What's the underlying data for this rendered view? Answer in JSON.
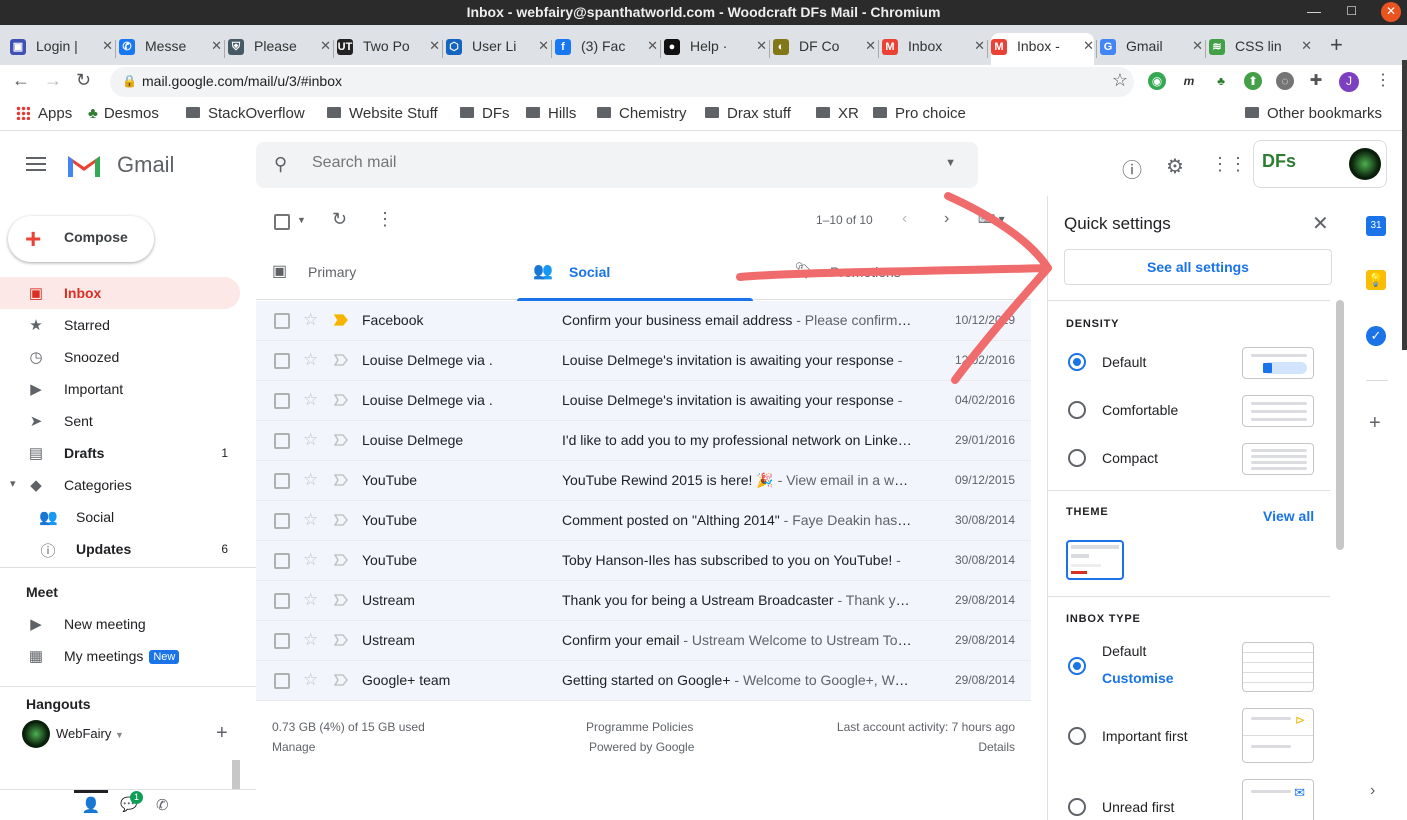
{
  "window": {
    "title": "Inbox - webfairy@spanthatworld.com - Woodcraft DFs Mail - Chromium"
  },
  "tabs": [
    {
      "label": "Login |",
      "color": "#3f51b5",
      "glyph": "▣"
    },
    {
      "label": "Messe",
      "color": "#1877f2",
      "glyph": "✆"
    },
    {
      "label": "Please",
      "color": "#455a64",
      "glyph": "⛨"
    },
    {
      "label": "Two Po",
      "color": "#222222",
      "glyph": "UT"
    },
    {
      "label": "User Li",
      "color": "#1565c0",
      "glyph": "⬡"
    },
    {
      "label": "(3) Fac",
      "color": "#1877f2",
      "glyph": "f"
    },
    {
      "label": "Help ·",
      "color": "#111111",
      "glyph": "●"
    },
    {
      "label": "DF Co",
      "color": "#827717",
      "glyph": "◐"
    },
    {
      "label": "Inbox",
      "color": "#ea4335",
      "glyph": "M"
    },
    {
      "label": "Inbox -",
      "color": "#ea4335",
      "glyph": "M"
    },
    {
      "label": "Gmail",
      "color": "#4285f4",
      "glyph": "G"
    },
    {
      "label": "CSS lin",
      "color": "#43a047",
      "glyph": "≋"
    }
  ],
  "address": {
    "url": "mail.google.com/mail/u/3/#inbox",
    "profile_initial": "J"
  },
  "bookmarks": [
    "Apps",
    "Desmos",
    "StackOverflow",
    "Website Stuff",
    "DFs",
    "Hills",
    "Chemistry",
    "Drax stuff",
    "XR",
    "Pro choice",
    "Other bookmarks"
  ],
  "gmail": {
    "logo_text": "Gmail",
    "search_placeholder": "Search mail",
    "account_badge": "DFs"
  },
  "compose": {
    "label": "Compose"
  },
  "nav": [
    {
      "label": "Inbox",
      "count": "",
      "icon": "inbox-icon"
    },
    {
      "label": "Starred",
      "count": "",
      "icon": "star-icon"
    },
    {
      "label": "Snoozed",
      "count": "",
      "icon": "clock-icon"
    },
    {
      "label": "Important",
      "count": "",
      "icon": "important-icon"
    },
    {
      "label": "Sent",
      "count": "",
      "icon": "send-icon"
    },
    {
      "label": "Drafts",
      "count": "1",
      "icon": "draft-icon"
    },
    {
      "label": "Categories",
      "count": "",
      "icon": "label-icon"
    },
    {
      "label": "Social",
      "count": "",
      "icon": "people-icon"
    },
    {
      "label": "Updates",
      "count": "6",
      "icon": "info-icon"
    }
  ],
  "meet": {
    "title": "Meet",
    "new_meeting": "New meeting",
    "my_meetings": "My meetings",
    "badge": "New"
  },
  "hangouts": {
    "title": "Hangouts",
    "user": "WebFairy",
    "notif_count": "1"
  },
  "toolbar": {
    "range": "1–10 of 10"
  },
  "category_tabs": [
    {
      "label": "Primary",
      "icon": "inbox-tab-icon"
    },
    {
      "label": "Social",
      "icon": "people-tab-icon"
    },
    {
      "label": "Promotions",
      "icon": "tag-tab-icon"
    }
  ],
  "emails": [
    {
      "from": "Facebook",
      "subject": "Confirm your business email address",
      "preview": " - Please confirm your business email address",
      "date": "10/12/2019",
      "important": true
    },
    {
      "from": "Louise Delmege via .",
      "subject": "Louise Delmege's invitation is awaiting your response",
      "preview": " -",
      "date": "12/02/2016",
      "important": false
    },
    {
      "from": "Louise Delmege via .",
      "subject": "Louise Delmege's invitation is awaiting your response",
      "preview": " -",
      "date": "04/02/2016",
      "important": false
    },
    {
      "from": "Louise Delmege",
      "subject": "I'd like to add you to my professional network on LinkedIn",
      "preview": "",
      "date": "29/01/2016",
      "important": false
    },
    {
      "from": "YouTube",
      "subject": "YouTube Rewind 2015 is here! 🎉",
      "preview": " - View email in a web browser",
      "date": "09/12/2015",
      "important": false
    },
    {
      "from": "YouTube",
      "subject": "Comment posted on \"Althing 2014\"",
      "preview": " - Faye Deakin has commented",
      "date": "30/08/2014",
      "important": false
    },
    {
      "from": "YouTube",
      "subject": "Toby Hanson-Iles has subscribed to you on YouTube!",
      "preview": " -",
      "date": "30/08/2014",
      "important": false
    },
    {
      "from": "Ustream",
      "subject": "Thank you for being a Ustream Broadcaster",
      "preview": " - Thank you for joining",
      "date": "29/08/2014",
      "important": false
    },
    {
      "from": "Ustream",
      "subject": "Confirm your email",
      "preview": " - Ustream Welcome to Ustream To get started",
      "date": "29/08/2014",
      "important": false
    },
    {
      "from": "Google+ team",
      "subject": "Getting started on Google+",
      "preview": " - Welcome to Google+, Webfairy",
      "date": "29/08/2014",
      "important": false
    }
  ],
  "footer": {
    "storage": "0.73 GB (4%) of 15 GB used",
    "manage": "Manage",
    "policies": "Programme Policies",
    "powered": "Powered by Google",
    "activity": "Last account activity: 7 hours ago",
    "details": "Details"
  },
  "quick_settings": {
    "title": "Quick settings",
    "see_all": "See all settings",
    "density_title": "DENSITY",
    "density": [
      "Default",
      "Comfortable",
      "Compact"
    ],
    "theme_title": "THEME",
    "view_all": "View all",
    "inbox_type_title": "INBOX TYPE",
    "inbox_types": [
      "Default",
      "Important first",
      "Unread first"
    ],
    "customise": "Customise"
  },
  "colors": {
    "accent": "#1a73e8",
    "gmail_red": "#d93025",
    "arrow": "#f06b6b"
  }
}
